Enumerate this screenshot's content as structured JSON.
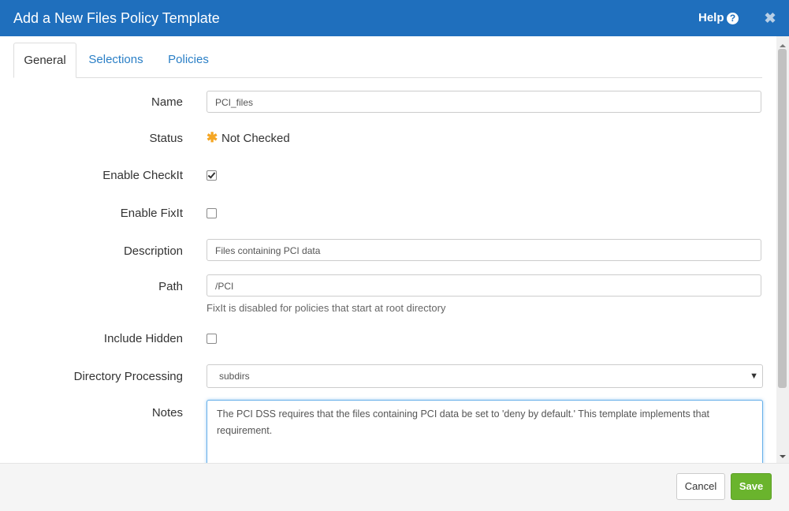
{
  "dialog": {
    "title": "Add a New Files Policy Template",
    "help_label": "Help",
    "help_icon_glyph": "?",
    "close_icon_glyph": "✖"
  },
  "tabs": [
    {
      "label": "General",
      "active": true
    },
    {
      "label": "Selections",
      "active": false
    },
    {
      "label": "Policies",
      "active": false
    }
  ],
  "form": {
    "name": {
      "label": "Name",
      "value": "PCI_files"
    },
    "status": {
      "label": "Status",
      "value": "Not Checked",
      "icon": "asterisk-icon",
      "icon_glyph": "✱"
    },
    "enable_checkit": {
      "label": "Enable CheckIt",
      "checked": true
    },
    "enable_fixit": {
      "label": "Enable FixIt",
      "checked": false
    },
    "description": {
      "label": "Description",
      "value": "Files containing PCI data"
    },
    "path": {
      "label": "Path",
      "value": "/PCI",
      "help": "FixIt is disabled for policies that start at root directory"
    },
    "include_hidden": {
      "label": "Include Hidden",
      "checked": false
    },
    "directory_processing": {
      "label": "Directory Processing",
      "selected": "subdirs",
      "caret_glyph": "▼"
    },
    "notes": {
      "label": "Notes",
      "value": "The PCI DSS requires that the files containing PCI data be set to 'deny by default.' This template implements that requirement."
    }
  },
  "footer": {
    "cancel_label": "Cancel",
    "save_label": "Save"
  },
  "colors": {
    "titlebar": "#1f6fbd",
    "tab_link": "#2a7fc6",
    "status_star": "#f5a623",
    "save_button": "#6ab42d"
  }
}
